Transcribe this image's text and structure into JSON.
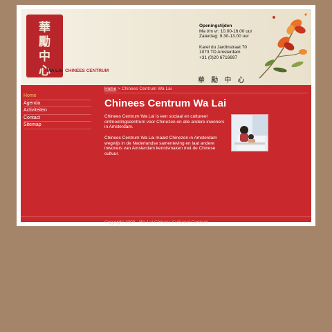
{
  "brand": {
    "seal_chars": [
      "華",
      "勵",
      "中",
      "心"
    ],
    "name": "WA LAI",
    "subtitle": "CHINEES CENTRUM",
    "chinese_signature": "華 勵 中 心"
  },
  "header_info": {
    "hours_title": "Openingstijden",
    "hours_weekdays": "Ma t/m vr: 10.00-16.00 uur",
    "hours_saturday": "Zaterdag: 9.30-13.00 uur",
    "address_street": "Karel du Jardinstraat 70",
    "address_city": "1073 TD Amsterdam",
    "phone": "+31 (0)20 6716697"
  },
  "nav": {
    "items": [
      {
        "label": "Home"
      },
      {
        "label": "Agenda"
      },
      {
        "label": "Activiteiten"
      },
      {
        "label": "Contact"
      },
      {
        "label": "Sitemap"
      }
    ]
  },
  "breadcrumb": {
    "home": "Home",
    "separator": " > ",
    "current": "Chinees Centrum Wa Lai"
  },
  "main": {
    "title": "Chinees Centrum Wa Lai",
    "paragraph_1": "Chinees Centrum Wa Lai is een sociaal en cultureel ontmoetingscentrum voor Chinezen en alle andere inwoners in Amsterdam.",
    "paragraph_2": "Chinees Centrum Wa Lai maakt Chinezen in Amsterdam wegwijs in de Nederlandse samenleving en laat andere inwoners van Amsterdam kennismaken met de Chinese cultuur."
  },
  "footer": {
    "copyright": "Copyright 2009 - Wa Lai Chinees Cultureel Centrum"
  },
  "colors": {
    "background": "#a5856a",
    "content_red": "#c9282c",
    "seal_red": "#b8262b",
    "active_nav": "#f8c66a"
  }
}
